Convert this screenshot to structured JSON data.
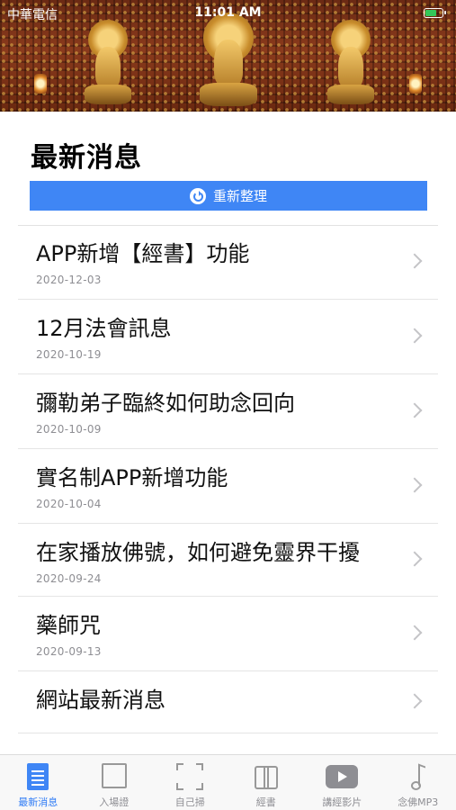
{
  "status_bar": {
    "carrier": "中華電信",
    "time": "11:01 AM",
    "battery_color": "#34c759"
  },
  "header": {
    "banner_icon": "buddha-shrine-image"
  },
  "page": {
    "title": "最新消息",
    "refresh_label": "重新整理",
    "refresh_icon": "refresh-icon",
    "accent_color": "#3f86f5"
  },
  "news": {
    "items": [
      {
        "title": "APP新增【經書】功能",
        "date": "2020-12-03"
      },
      {
        "title": "12月法會訊息",
        "date": "2020-10-19"
      },
      {
        "title": "彌勒弟子臨終如何助念回向",
        "date": "2020-10-09"
      },
      {
        "title": "實名制APP新增功能",
        "date": "2020-10-04"
      },
      {
        "title": "在家播放佛號，如何避免靈界干擾",
        "date": "2020-09-24"
      },
      {
        "title": "藥師咒",
        "date": "2020-09-13"
      },
      {
        "title": "網站最新消息",
        "date": ""
      }
    ]
  },
  "tabbar": {
    "tabs": [
      {
        "label": "最新消息",
        "icon": "news-icon",
        "active": true
      },
      {
        "label": "入場證",
        "icon": "badge-icon",
        "active": false
      },
      {
        "label": "自己掃",
        "icon": "scan-icon",
        "active": false
      },
      {
        "label": "經書",
        "icon": "book-icon",
        "active": false
      },
      {
        "label": "講經影片",
        "icon": "video-icon",
        "active": false
      },
      {
        "label": "念佛MP3",
        "icon": "music-icon",
        "active": false
      }
    ]
  }
}
